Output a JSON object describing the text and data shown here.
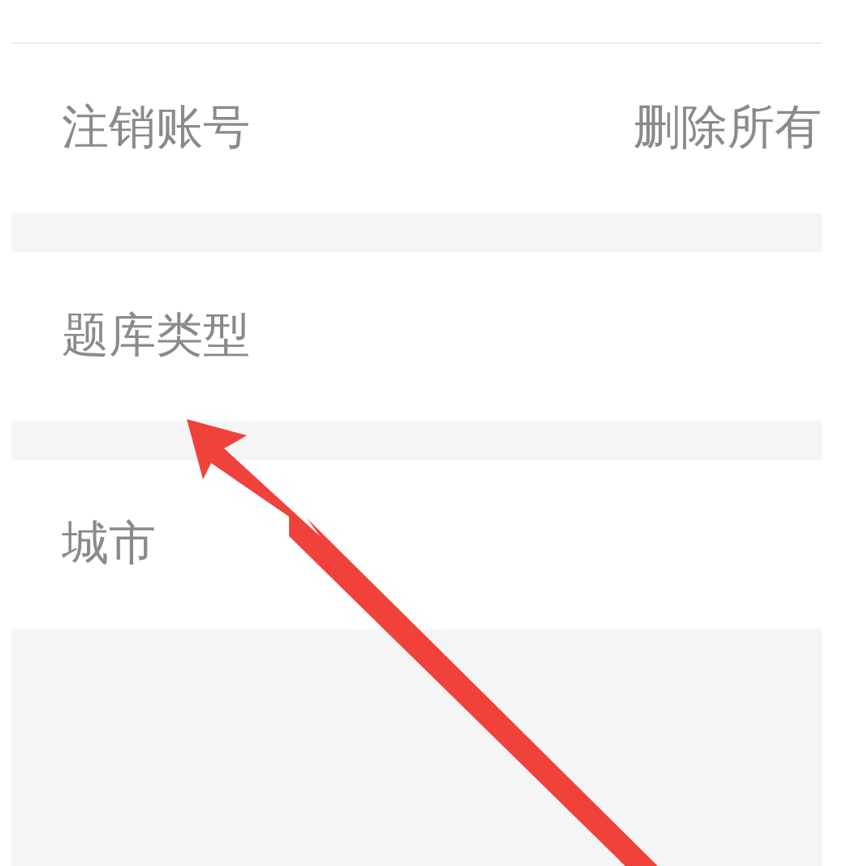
{
  "settings": [
    {
      "label": "注销账号",
      "value": "删除所有"
    },
    {
      "label": "题库类型"
    },
    {
      "label": "城市"
    }
  ]
}
